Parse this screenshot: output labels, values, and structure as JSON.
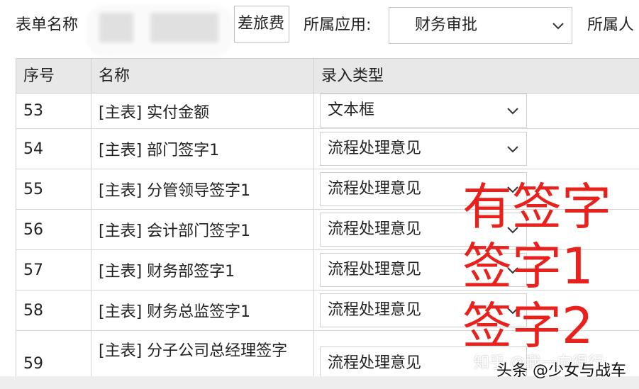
{
  "toolbar": {
    "form_name_label": "表单名称",
    "form_name_value": "差旅费",
    "app_label": "所属应用:",
    "app_value": "财务审批",
    "owner_label": "所属人"
  },
  "table": {
    "headers": [
      "序号",
      "名称",
      "录入类型"
    ],
    "rows": [
      {
        "num": "53",
        "name": "[主表] 实付金额",
        "type": "文本框"
      },
      {
        "num": "54",
        "name": "[主表] 部门签字1",
        "type": "流程处理意见"
      },
      {
        "num": "55",
        "name": "[主表] 分管领导签字1",
        "type": "流程处理意见"
      },
      {
        "num": "56",
        "name": "[主表] 会计部门签字1",
        "type": "流程处理意见"
      },
      {
        "num": "57",
        "name": "[主表] 财务部签字1",
        "type": "流程处理意见"
      },
      {
        "num": "58",
        "name": "[主表] 财务总监签字1",
        "type": "流程处理意见"
      },
      {
        "num": "59",
        "name": "[主表] 分子公司总经理签字",
        "type": "流程处理意见"
      }
    ]
  },
  "annotations": [
    "有签字",
    "签字1",
    "签字2"
  ],
  "watermarks": {
    "zhihu": "知乎 @我一向很行",
    "toutiao": "头条 @少女与战车"
  },
  "colors": {
    "annotation": "#e8211d",
    "header_bg": "#e8e8e8",
    "grid_line": "#cfcfcf"
  },
  "icons": {
    "dropdown": "chevron-down-icon"
  }
}
